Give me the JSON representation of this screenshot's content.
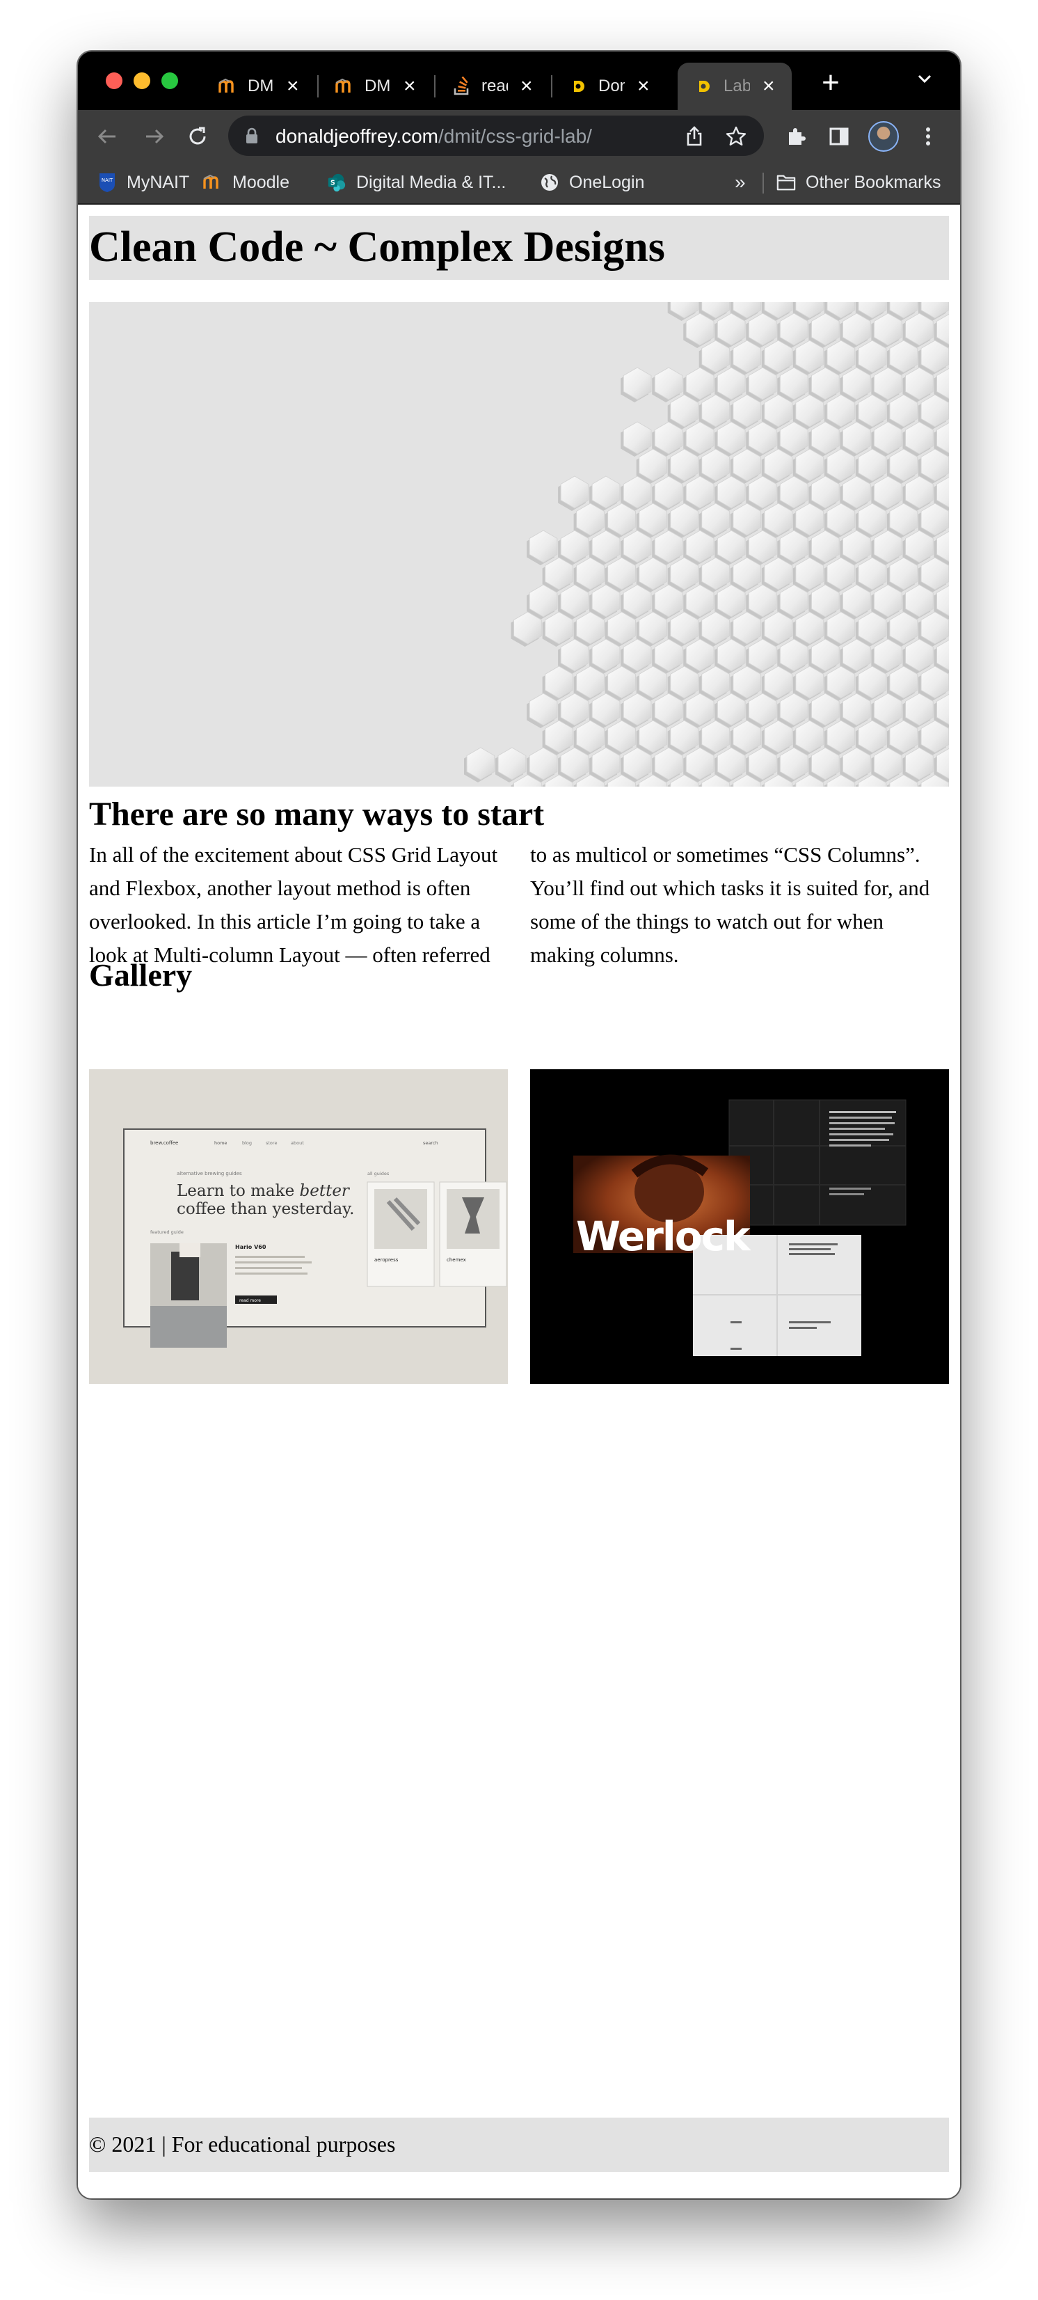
{
  "browser": {
    "tabs": [
      {
        "title": "DMIT",
        "favicon": "moodle-icon",
        "active": false
      },
      {
        "title": "DMIT",
        "favicon": "moodle-icon",
        "active": false
      },
      {
        "title": "read",
        "favicon": "stackoverflow-icon",
        "active": false
      },
      {
        "title": "Don",
        "favicon": "site-logo-icon",
        "active": false
      },
      {
        "title": "Lab",
        "favicon": "site-logo-icon",
        "active": true
      }
    ],
    "url_host": "donaldjeoffrey.com",
    "url_path": "/dmit/css-grid-lab/",
    "bookmarks": [
      {
        "label": "MyNAIT",
        "icon": "nait-icon"
      },
      {
        "label": "Moodle",
        "icon": "moodle-icon"
      },
      {
        "label": "Digital Media & IT...",
        "icon": "sharepoint-icon"
      },
      {
        "label": "OneLogin",
        "icon": "globe-icon"
      }
    ],
    "overflow_label": "»",
    "other_bookmarks": "Other Bookmarks"
  },
  "page": {
    "site_title": "Clean Code ~ Complex Designs",
    "hero_image": "white hexagon wall",
    "section_heading": "There are so many ways to start",
    "article_text": "In all of the excitement about CSS Grid Layout and Flexbox, another layout method is often overlooked. In this article I’m going to take a look at Multi-column Layout — often referred to as multicol or sometimes “CSS Columns”. You’ll find out which tasks it is suited for, and some of the things to watch out for when making columns.",
    "gallery_heading": "Gallery",
    "gallery": [
      {
        "alt": "brew coffee website mockup",
        "brand": "brew.coffee",
        "nav": [
          "home",
          "blog",
          "store",
          "about"
        ],
        "search": "search",
        "eyebrow": "alternative brewing guides",
        "headline_1": "Learn to make",
        "headline_em": "better",
        "headline_2": "coffee than yesterday.",
        "featured": "featured guide",
        "all_guides": "all guides",
        "product": "Hario V60",
        "cards": [
          "aeropress",
          "chemex"
        ],
        "cta": "read more"
      },
      {
        "alt": "Werlock poster design",
        "brand_word": "Werlock"
      }
    ],
    "footer_text": "© 2021 | For educational purposes"
  },
  "colors": {
    "tabstrip": "#000000",
    "toolbar": "#3c3c3c",
    "omnibox": "#202124",
    "header_bg": "#e2e2e2",
    "footer_bg": "#e2e2e2"
  }
}
